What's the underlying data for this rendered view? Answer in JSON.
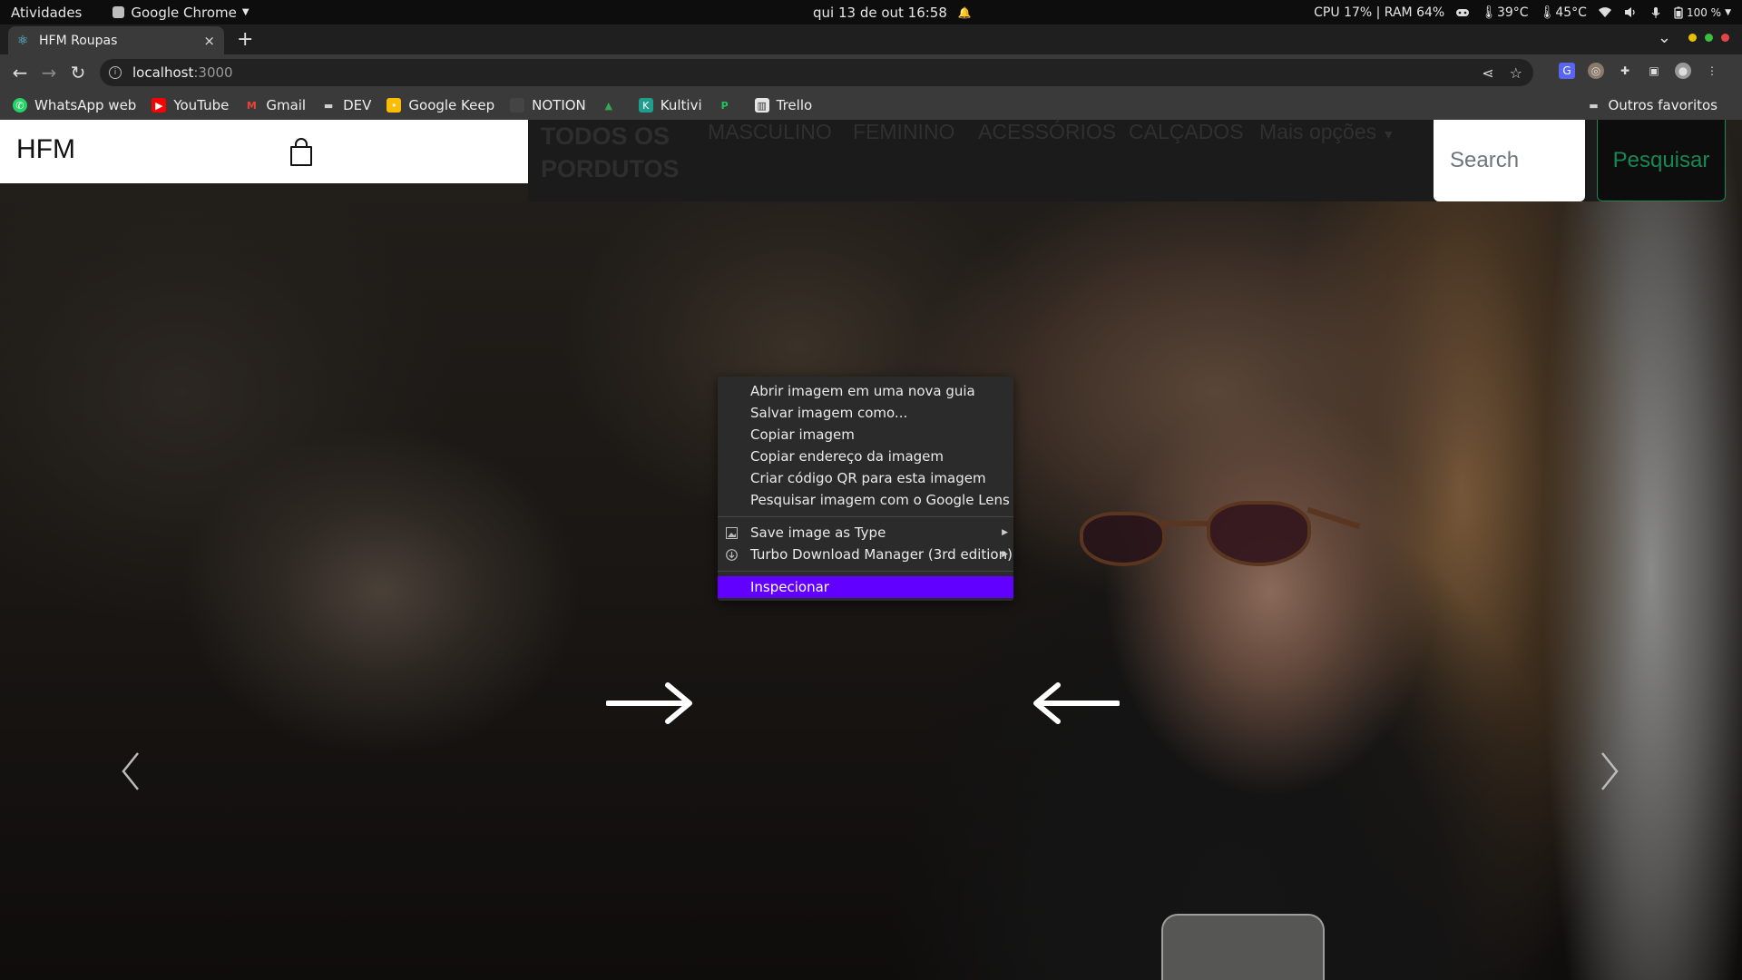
{
  "system_bar": {
    "activities": "Atividades",
    "app_name": "Google Chrome",
    "datetime": "qui 13 de out  16:58",
    "cpu": "CPU  17% | RAM  64%",
    "temp1": "39°C",
    "temp2": "45°C",
    "battery": "100 %"
  },
  "browser": {
    "tab_title": "HFM Roupas",
    "tab_close": "×",
    "new_tab": "+",
    "url_host": "localhost",
    "url_port": ":3000",
    "window_dot_colors": [
      "#e5c100",
      "#3dbf3d",
      "#e64545"
    ]
  },
  "bookmarks": {
    "items": [
      {
        "label": "WhatsApp web",
        "icon": "whatsapp-icon",
        "color": "#25d366"
      },
      {
        "label": "YouTube",
        "icon": "youtube-icon",
        "color": "#ff0000"
      },
      {
        "label": "Gmail",
        "icon": "gmail-icon",
        "color": "#ea4335"
      },
      {
        "label": "DEV",
        "icon": "folder-icon",
        "color": "#cfcfcf"
      },
      {
        "label": "Google Keep",
        "icon": "keep-icon",
        "color": "#fbbc04"
      },
      {
        "label": "NOTION",
        "icon": "notion-icon",
        "color": "#444444"
      },
      {
        "label": "",
        "icon": "drive-icon",
        "color": "#34a853"
      },
      {
        "label": "Kultivi",
        "icon": "kultivi-icon",
        "color": "#1f9e8e"
      },
      {
        "label": "",
        "icon": "p-icon",
        "color": "#22c55e"
      },
      {
        "label": "Trello",
        "icon": "trello-icon",
        "color": "#e5e5e5"
      }
    ],
    "other": "Outros favoritos"
  },
  "site": {
    "logo": "HFM",
    "nav": {
      "all_products": "TODOS OS PORDUTOS",
      "masculino": "MASCULINO",
      "feminino": "FEMININO",
      "acessorios": "ACESSÓRIOS",
      "calcados": "CALÇADOS",
      "mais_opcoes": "Mais opções"
    },
    "search_placeholder": "Search",
    "search_button": "Pesquisar",
    "accent_color": "#198754"
  },
  "context_menu": {
    "items": [
      "Abrir imagem em uma nova guia",
      "Salvar imagem como...",
      "Copiar imagem",
      "Copiar endereço da imagem",
      "Criar código QR para esta imagem",
      "Pesquisar imagem com o Google Lens"
    ],
    "extensions": [
      {
        "label": "Save image as Type",
        "icon": "image-icon"
      },
      {
        "label": "Turbo Download Manager (3rd edition)",
        "icon": "download-icon"
      }
    ],
    "highlighted": "Inspecionar",
    "highlight_color": "#6200ff"
  }
}
